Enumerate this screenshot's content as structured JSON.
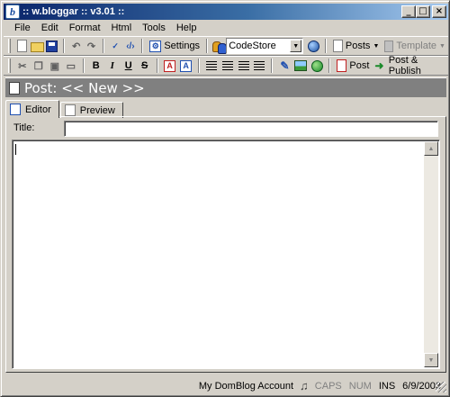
{
  "window": {
    "title": ":: w.bloggar :: v3.01 ::",
    "app_icon_letter": "b"
  },
  "caption_buttons": {
    "minimize": "_",
    "maximize": "□",
    "close": "×"
  },
  "menu": [
    {
      "label": "File",
      "accel": "F"
    },
    {
      "label": "Edit",
      "accel": "E"
    },
    {
      "label": "Format",
      "accel": "o"
    },
    {
      "label": "Html",
      "accel": "m"
    },
    {
      "label": "Tools",
      "accel": "T"
    },
    {
      "label": "Help",
      "accel": "H"
    }
  ],
  "toolbar1": {
    "settings_label": "Settings",
    "account_selected": "CodeStore",
    "posts_label": "Posts",
    "template_label": "Template"
  },
  "toolbar2": {
    "bold": "B",
    "italic": "I",
    "underline": "U",
    "strike": "S",
    "post_label": "Post",
    "post_publish_label": "Post & Publish"
  },
  "post_header": {
    "title": "Post: << New >>"
  },
  "tabs": [
    {
      "label": "Editor"
    },
    {
      "label": "Preview"
    }
  ],
  "form": {
    "title_label": "Title:",
    "title_value": "",
    "body_value": ""
  },
  "status": {
    "account": "My DomBlog Account",
    "caps": "CAPS",
    "num": "NUM",
    "ins": "INS",
    "date": "6/9/2003"
  },
  "colors": {
    "titlebar_start": "#0a246a",
    "titlebar_end": "#a6caf0",
    "face": "#d4d0c8",
    "header": "#808080"
  }
}
